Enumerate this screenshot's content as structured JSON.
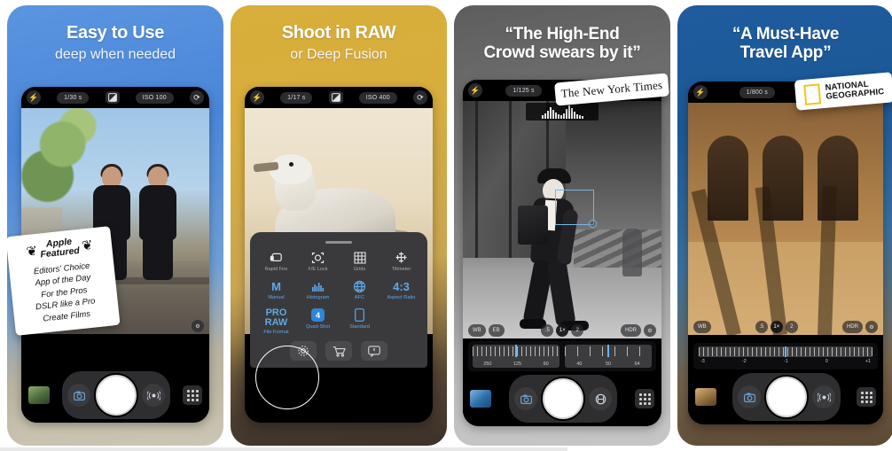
{
  "app_store_gallery": {
    "panel_count": 4,
    "panels": [
      {
        "id": "panel-easy-to-use",
        "headline": "Easy to Use",
        "subhead": "deep when needed",
        "bg_accent": "#4a86d8",
        "camera": {
          "flash_icon": "flash-off-icon",
          "shutter_speed": "1/30 s",
          "exposure_icon": "exposure-compensation-icon",
          "iso": "ISO 100",
          "flip_icon": "camera-flip-icon",
          "thumbnail_name": "last-photo-thumbnail",
          "mode_icon": "camera-mode-icon",
          "audio_icon": "live-photo-icon",
          "grid_icon": "grid-menu-icon",
          "shutter_label": "shutter-button"
        },
        "award_badge": {
          "laurel_left": "❦",
          "laurel_right": "❦",
          "title_line1": "Apple",
          "title_line2": "Featured",
          "items": [
            "Editors' Choice",
            "App of the Day",
            "For the Pros",
            "DSLR like a Pro",
            "Create Films"
          ]
        }
      },
      {
        "id": "panel-shoot-in-raw",
        "headline": "Shoot in RAW",
        "subhead": "or Deep Fusion",
        "bg_accent": "#d9ae3a",
        "camera": {
          "flash_icon": "flash-off-icon",
          "shutter_speed": "1/17 s",
          "exposure_icon": "exposure-compensation-icon",
          "iso": "ISO 400",
          "flip_icon": "camera-flip-icon"
        },
        "control_sheet": {
          "row1": [
            {
              "glyph": "❐",
              "label": "Rapid Fire",
              "icon": "rapid-fire-icon",
              "active": false
            },
            {
              "glyph": "⛶",
              "label": "F/E Lock",
              "icon": "focus-exposure-lock-icon",
              "active": false
            },
            {
              "glyph": "▦",
              "label": "Grids",
              "icon": "grids-icon",
              "active": false
            },
            {
              "glyph": "✛",
              "label": "Tiltmeter",
              "icon": "tiltmeter-icon",
              "active": false
            }
          ],
          "row2": [
            {
              "glyph": "M",
              "label": "Manual",
              "icon": "manual-mode-icon",
              "active": true
            },
            {
              "glyph": "▐█▌",
              "label": "Histogram",
              "icon": "histogram-icon",
              "active": true
            },
            {
              "glyph": "♁",
              "label": "AFC",
              "icon": "afc-icon",
              "active": true
            },
            {
              "glyph": "4:3",
              "label": "Aspect Ratio",
              "icon": "aspect-ratio-icon",
              "active": true
            }
          ],
          "row3": [
            {
              "glyph": "PRO RAW",
              "label": "File Format",
              "icon": "pro-raw-icon",
              "active": true,
              "highlighted": true
            },
            {
              "glyph": "4",
              "label": "Quad-Shot",
              "icon": "quad-shot-icon",
              "active": true
            },
            {
              "glyph": "▯",
              "label": "Standard",
              "icon": "standard-icon",
              "active": true
            }
          ],
          "actions": [
            {
              "glyph": "⚙",
              "icon": "settings-gear-icon"
            },
            {
              "glyph": "E",
              "icon": "shopping-cart-icon"
            },
            {
              "glyph": "⌨",
              "icon": "feedback-icon"
            }
          ]
        }
      },
      {
        "id": "panel-nyt-quote",
        "headline_line1": "“The High-End",
        "headline_line2": "Crowd swears by it”",
        "bg_accent": "#8d8d8d",
        "press_badge": "The New York Times",
        "camera": {
          "flash_icon": "flash-off-icon",
          "shutter_speed": "1/125 s",
          "histogram_icon": "histogram-overlay-icon",
          "focus_box": "focus-rectangle",
          "thumbnail_name": "last-photo-thumbnail",
          "mode_icon": "camera-mode-icon",
          "timer_icon": "timer-icon",
          "grid_icon": "grid-menu-icon"
        },
        "lens_row": {
          "wb": "WB",
          "eb": "EB",
          "zooms": [
            ".5",
            "1×",
            "2"
          ],
          "hdr": "HDR",
          "more_icon": "more-options-icon"
        },
        "dials": [
          {
            "name": "shutter-dial",
            "labels": [
              "250",
              "125",
              "60"
            ]
          },
          {
            "name": "iso-dial",
            "labels": [
              "40",
              "50",
              "64"
            ]
          }
        ]
      },
      {
        "id": "panel-natgeo-quote",
        "headline_line1": "“A Must-Have",
        "headline_line2": "Travel App”",
        "bg_accent": "#1f5c9e",
        "press_badge": {
          "line1": "NATIONAL",
          "line2": "GEOGRAPHIC",
          "mark_color": "#f0c419",
          "mark_icon": "natgeo-rectangle-icon"
        },
        "camera": {
          "flash_icon": "flash-off-icon",
          "shutter_speed": "1/800 s",
          "exposure_value": "-1.0",
          "thumbnail_name": "last-photo-thumbnail",
          "mode_icon": "camera-mode-icon",
          "audio_icon": "live-photo-icon",
          "grid_icon": "grid-menu-icon"
        },
        "lens_row": {
          "wb": "WB",
          "zooms": [
            ".5",
            "1×",
            "2"
          ],
          "hdr": "HDR",
          "more_icon": "more-options-icon"
        },
        "exposure_slider": {
          "name": "exposure-slider",
          "labels": [
            "-3",
            "-2",
            "-1",
            "0",
            "+1"
          ]
        }
      }
    ]
  }
}
